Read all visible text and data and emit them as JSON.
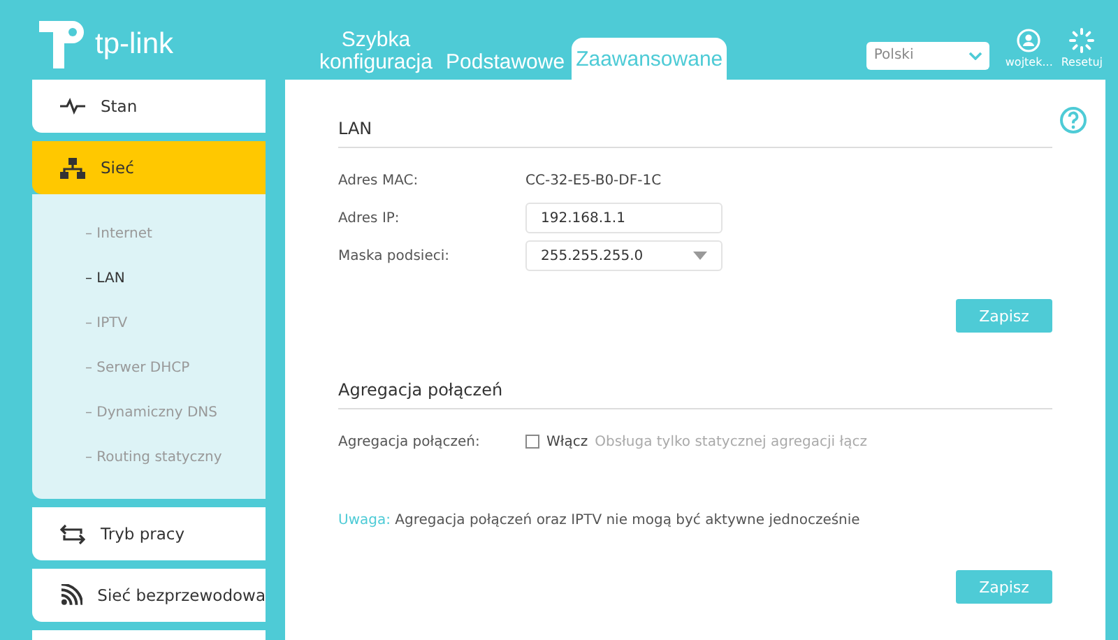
{
  "header": {
    "logo_text": "tp-link",
    "tabs": [
      {
        "label": "Szybka konfiguracja",
        "selected": false
      },
      {
        "label": "Podstawowe",
        "selected": false
      },
      {
        "label": "Zaawansowane",
        "selected": true
      }
    ],
    "language": "Polski",
    "user": "wojtek...",
    "reset": "Resetuj"
  },
  "sidebar": {
    "items": [
      {
        "kind": "status",
        "label": "Stan",
        "selected": false,
        "expanded": false
      },
      {
        "kind": "network",
        "label": "Sieć",
        "selected": true,
        "expanded": true,
        "children": [
          {
            "label": "– Internet",
            "selected": false
          },
          {
            "label": "– LAN",
            "selected": true
          },
          {
            "label": "– IPTV",
            "selected": false
          },
          {
            "label": "– Serwer DHCP",
            "selected": false
          },
          {
            "label": "– Dynamiczny DNS",
            "selected": false
          },
          {
            "label": "– Routing statyczny",
            "selected": false
          }
        ]
      },
      {
        "kind": "mode",
        "label": "Tryb pracy",
        "selected": false,
        "expanded": false
      },
      {
        "kind": "wireless",
        "label": "Sieć bezprzewodowa",
        "selected": false,
        "expanded": false
      }
    ]
  },
  "sections": [
    {
      "title": "LAN",
      "rows": [
        {
          "kind": "text",
          "label": "Adres MAC:",
          "value": "CC-32-E5-B0-DF-1C"
        },
        {
          "kind": "input",
          "label": "Adres IP:",
          "value": "192.168.1.1"
        },
        {
          "kind": "select",
          "label": "Maska podsieci:",
          "value": "255.255.255.0"
        }
      ],
      "button": "Zapisz"
    },
    {
      "title": "Agregacja połączeń",
      "rows": [
        {
          "kind": "checkbox",
          "label": "Agregacja połączeń:",
          "checkbox_label": "Włącz",
          "checked": false,
          "hint": "Obsługa tylko statycznej agregacji łącz"
        }
      ],
      "note": {
        "label": "Uwaga:",
        "text": "Agregacja połączeń oraz IPTV nie mogą być aktywne jednocześnie"
      },
      "button": "Zapisz"
    }
  ]
}
